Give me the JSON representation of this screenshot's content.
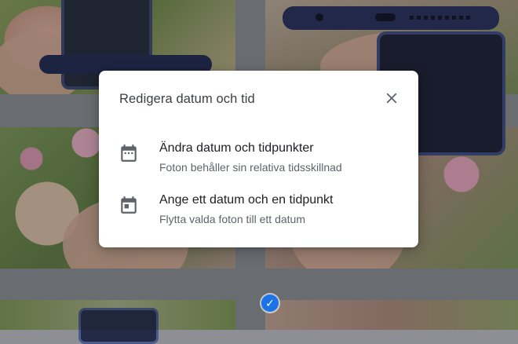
{
  "dialog": {
    "title": "Redigera datum och tid",
    "close_icon": "close-icon",
    "options": [
      {
        "icon": "calendar-range-icon",
        "title": "Ändra datum och tidpunkter",
        "subtitle": "Foton behåller sin relativa tidsskillnad"
      },
      {
        "icon": "calendar-event-icon",
        "title": "Ange ett datum och en tidpunkt",
        "subtitle": "Flytta valda foton till ett datum"
      }
    ]
  },
  "background": {
    "selection_icon": "check-circle-icon",
    "accent_color": "#1a73e8",
    "scrim_color": "#202124"
  }
}
